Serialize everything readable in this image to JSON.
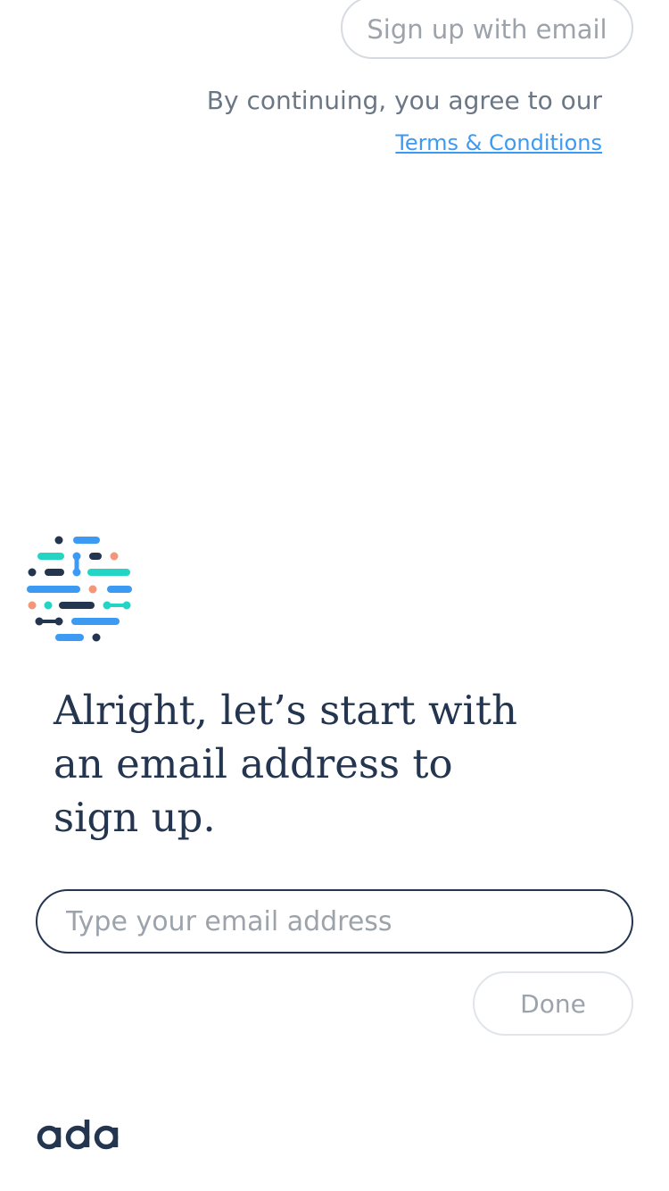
{
  "header": {
    "signup_email_label": "Sign up with email",
    "agree_text": "By continuing, you agree to our",
    "terms_link": "Terms & Conditions"
  },
  "chat": {
    "prompt_line1": "Alright, let’s start with",
    "prompt_line2": "an email address to",
    "prompt_line3": "sign up."
  },
  "form": {
    "email_placeholder": "Type your email address",
    "email_value": "",
    "done_label": "Done"
  },
  "brand": {
    "logo_text": "ada",
    "logo_color": "#24354f"
  },
  "colors": {
    "navy": "#24354f",
    "blue": "#3d9af2",
    "teal": "#24d4c4",
    "coral": "#f3977b",
    "muted_text": "#6b7785",
    "placeholder": "#9ca3ab"
  },
  "icons": {
    "assistant_avatar": "ada-bot-logo-icon"
  }
}
